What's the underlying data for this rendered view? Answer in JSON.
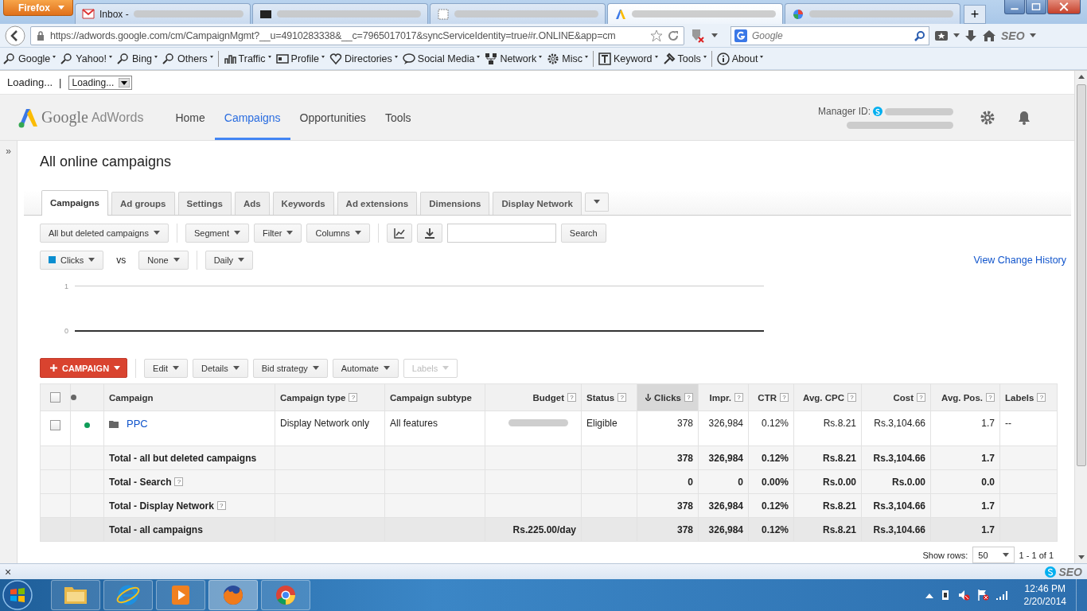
{
  "browser": {
    "menu_button": "Firefox",
    "tabs": [
      {
        "title": "Inbox -",
        "selected": false
      },
      {
        "selected": false
      },
      {
        "selected": false
      },
      {
        "selected": true
      },
      {
        "selected": false
      }
    ],
    "new_tab": "+",
    "url": "https://adwords.google.com/cm/CampaignMgmt?__u=4910283338&__c=7965017017&syncServiceIdentity=true#r.ONLINE&app=cm",
    "search_placeholder": "Google",
    "toolbar_label": "SEO",
    "bookmarks": [
      {
        "label": "Google"
      },
      {
        "label": "Yahoo!"
      },
      {
        "label": "Bing"
      },
      {
        "label": "Others"
      },
      {
        "label": "Traffic"
      },
      {
        "label": "Profile"
      },
      {
        "label": "Directories"
      },
      {
        "label": "Social Media"
      },
      {
        "label": "Network"
      },
      {
        "label": "Misc"
      },
      {
        "label": "Keyword"
      },
      {
        "label": "Tools"
      },
      {
        "label": "About"
      }
    ],
    "status_text": "Loading...",
    "status_separator": "|",
    "status_select": "Loading..."
  },
  "header": {
    "logo_google": "Google",
    "logo_product": "AdWords",
    "nav": [
      {
        "label": "Home",
        "selected": false
      },
      {
        "label": "Campaigns",
        "selected": true
      },
      {
        "label": "Opportunities",
        "selected": false
      },
      {
        "label": "Tools",
        "selected": false
      }
    ],
    "manager_label": "Manager ID:"
  },
  "page": {
    "collapse": "»",
    "title": "All online campaigns",
    "tabs": [
      {
        "label": "Campaigns",
        "selected": true
      },
      {
        "label": "Ad groups",
        "selected": false
      },
      {
        "label": "Settings",
        "selected": false
      },
      {
        "label": "Ads",
        "selected": false
      },
      {
        "label": "Keywords",
        "selected": false
      },
      {
        "label": "Ad extensions",
        "selected": false
      },
      {
        "label": "Dimensions",
        "selected": false
      },
      {
        "label": "Display Network",
        "selected": false
      }
    ],
    "filters": [
      "All but deleted campaigns",
      "Segment",
      "Filter",
      "Columns"
    ],
    "search_button": "Search",
    "metric": {
      "label": "Clicks",
      "color": "#0b8ed0"
    },
    "vs": "vs",
    "compare": "None",
    "period": "Daily",
    "change_history": "View Change History",
    "chart_ticks": [
      "1",
      "0"
    ],
    "actions": [
      {
        "label": "CAMPAIGN",
        "kind": "primary",
        "disabled": false
      },
      {
        "label": "Edit",
        "kind": "menu",
        "disabled": false
      },
      {
        "label": "Details",
        "kind": "menu",
        "disabled": false
      },
      {
        "label": "Bid strategy",
        "kind": "menu",
        "disabled": false
      },
      {
        "label": "Automate",
        "kind": "menu",
        "disabled": false
      },
      {
        "label": "Labels",
        "kind": "menu",
        "disabled": true
      }
    ]
  },
  "table": {
    "select_all": {
      "checked": false
    },
    "columns": [
      {
        "label": "Campaign",
        "sorted": false
      },
      {
        "label": "Campaign type",
        "help": "?",
        "sorted": false
      },
      {
        "label": "Campaign subtype",
        "sorted": false
      },
      {
        "label": "Budget",
        "help": "?",
        "sorted": false
      },
      {
        "label": "Status",
        "help": "?",
        "sorted": false
      },
      {
        "label": "Clicks",
        "help": "?",
        "sorted": true
      },
      {
        "label": "Impr.",
        "help": "?",
        "sorted": false
      },
      {
        "label": "CTR",
        "help": "?",
        "sorted": false
      },
      {
        "label": "Avg. CPC",
        "help": "?",
        "sorted": false
      },
      {
        "label": "Cost",
        "help": "?",
        "sorted": false
      },
      {
        "label": "Avg. Pos.",
        "help": "?",
        "sorted": false
      },
      {
        "label": "Labels",
        "help": "?",
        "sorted": false
      }
    ],
    "rows": [
      {
        "kind": "campaign",
        "checked": false,
        "color": "#0f9d58",
        "cells": [
          "PPC",
          "Display Network only",
          "All features",
          null,
          "Eligible",
          "378",
          "326,984",
          "0.12%",
          "Rs.8.21",
          "Rs.3,104.66",
          "1.7",
          "--"
        ]
      },
      {
        "kind": "total",
        "cells": [
          "Total - all but deleted campaigns",
          null,
          null,
          null,
          null,
          "378",
          "326,984",
          "0.12%",
          "Rs.8.21",
          "Rs.3,104.66",
          "1.7",
          null
        ]
      },
      {
        "kind": "total",
        "help": "?",
        "cells": [
          "Total - Search",
          null,
          null,
          null,
          null,
          "0",
          "0",
          "0.00%",
          "Rs.0.00",
          "Rs.0.00",
          "0.0",
          null
        ]
      },
      {
        "kind": "total",
        "help": "?",
        "cells": [
          "Total - Display Network",
          null,
          null,
          null,
          null,
          "378",
          "326,984",
          "0.12%",
          "Rs.8.21",
          "Rs.3,104.66",
          "1.7",
          null
        ]
      },
      {
        "kind": "grand",
        "cells": [
          "Total - all campaigns",
          null,
          null,
          "Rs.225.00/day",
          null,
          "378",
          "326,984",
          "0.12%",
          "Rs.8.21",
          "Rs.3,104.66",
          "1.7",
          null
        ]
      }
    ],
    "show_rows_label": "Show rows:",
    "show_rows": "50",
    "range": "1 - 1 of 1"
  },
  "addon_bar": {
    "close": "×",
    "label": "SEO"
  },
  "taskbar": {
    "apps": [
      {
        "active": false
      },
      {
        "active": false
      },
      {
        "active": false
      },
      {
        "active": true
      },
      {
        "active": false
      }
    ],
    "time": "12:46 PM",
    "date": "2/20/2014"
  }
}
